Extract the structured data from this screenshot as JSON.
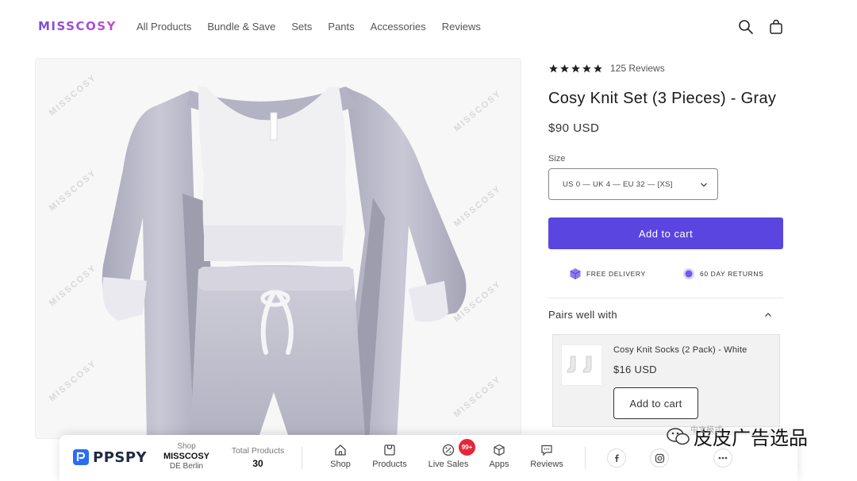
{
  "header": {
    "logo": "MISSCOSY",
    "nav": [
      "All Products",
      "Bundle & Save",
      "Sets",
      "Pants",
      "Accessories",
      "Reviews"
    ],
    "icons": [
      "search-icon",
      "cart-icon"
    ]
  },
  "product": {
    "image_watermark": "MISSCOSY",
    "rating": 5,
    "reviews": "125 Reviews",
    "title": "Cosy Knit Set (3 Pieces) - Gray",
    "price": "$90 USD",
    "size_label": "Size",
    "size_value": "US 0 — UK 4 — EU 32 — [XS]",
    "add_to_cart": "Add to cart",
    "features": {
      "delivery": "FREE DELIVERY",
      "returns": "60 DAY RETURNS"
    },
    "pairs_title": "Pairs well with",
    "pair": {
      "name": "Cosy Knit Socks (2 Pack) - White",
      "price": "$16 USD",
      "add_to_cart": "Add to cart"
    }
  },
  "colors": {
    "accent": "#5a45e0",
    "badge": "#e5263a",
    "pp_blue": "#2a6df5"
  },
  "ppspy": {
    "logo": "PPSPY",
    "shop_label": "Shop",
    "shop_name": "MISSCOSY",
    "shop_location": "DE Berlin",
    "total_label": "Total Products",
    "total_value": "30",
    "items": [
      "Shop",
      "Products",
      "Live Sales",
      "Apps",
      "Reviews"
    ],
    "badge": "99+"
  },
  "overlay": {
    "main": "皮皮广告选品",
    "small": "中文模式"
  }
}
